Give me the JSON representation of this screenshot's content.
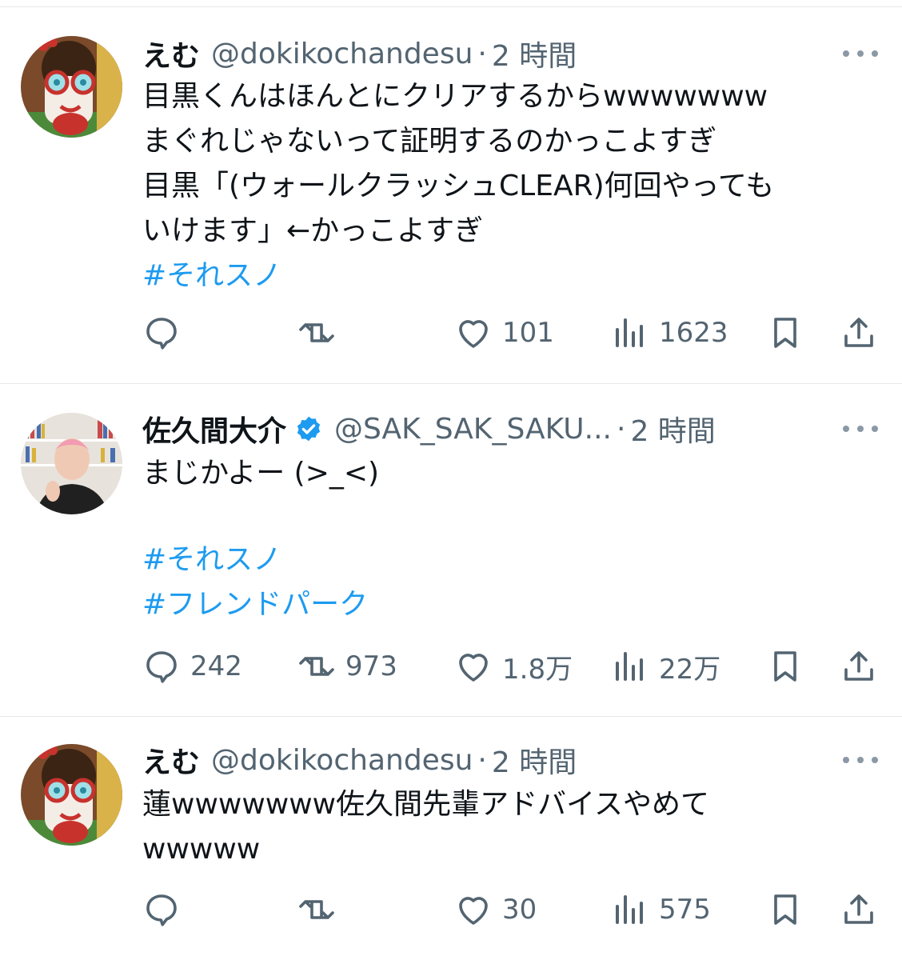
{
  "tweets": [
    {
      "name": "えむ",
      "handle": "@dokikochandesu",
      "dot": "·",
      "time": "2 時間",
      "lines": [
        "目黒くんはほんとにクリアするからwwwwwww",
        "まぐれじゃないって証明するのかっこよすぎ",
        "目黒「(ウォールクラッシュCLEAR)何回やっても",
        "いけます」←かっこよすぎ"
      ],
      "hashtags": [
        "#それスノ"
      ],
      "stats": {
        "reply": "",
        "retweet": "",
        "like": "101",
        "views": "1623"
      }
    },
    {
      "name": "佐久間大介",
      "handle": "@SAK_SAK_SAKU...",
      "dot": "·",
      "time": "2 時間",
      "lines": [
        "まじかよー (>_<)"
      ],
      "hashtags": [
        "#それスノ",
        "#フレンドパーク"
      ],
      "stats": {
        "reply": "242",
        "retweet": "973",
        "like": "1.8万",
        "views": "22万"
      }
    },
    {
      "name": "えむ",
      "handle": "@dokikochandesu",
      "dot": "·",
      "time": "2 時間",
      "lines": [
        "蓮wwwwwww佐久間先輩アドバイスやめて",
        "wwwww"
      ],
      "hashtags": [],
      "stats": {
        "reply": "",
        "retweet": "",
        "like": "30",
        "views": "575"
      }
    }
  ],
  "colors": {
    "text": "#0f1419",
    "muted": "#536471",
    "link": "#1d9bf0",
    "verified": "#1d9bf0"
  },
  "icons": [
    "reply-icon",
    "retweet-icon",
    "like-icon",
    "views-icon",
    "bookmark-icon",
    "share-icon",
    "more-icon",
    "verified-icon"
  ]
}
